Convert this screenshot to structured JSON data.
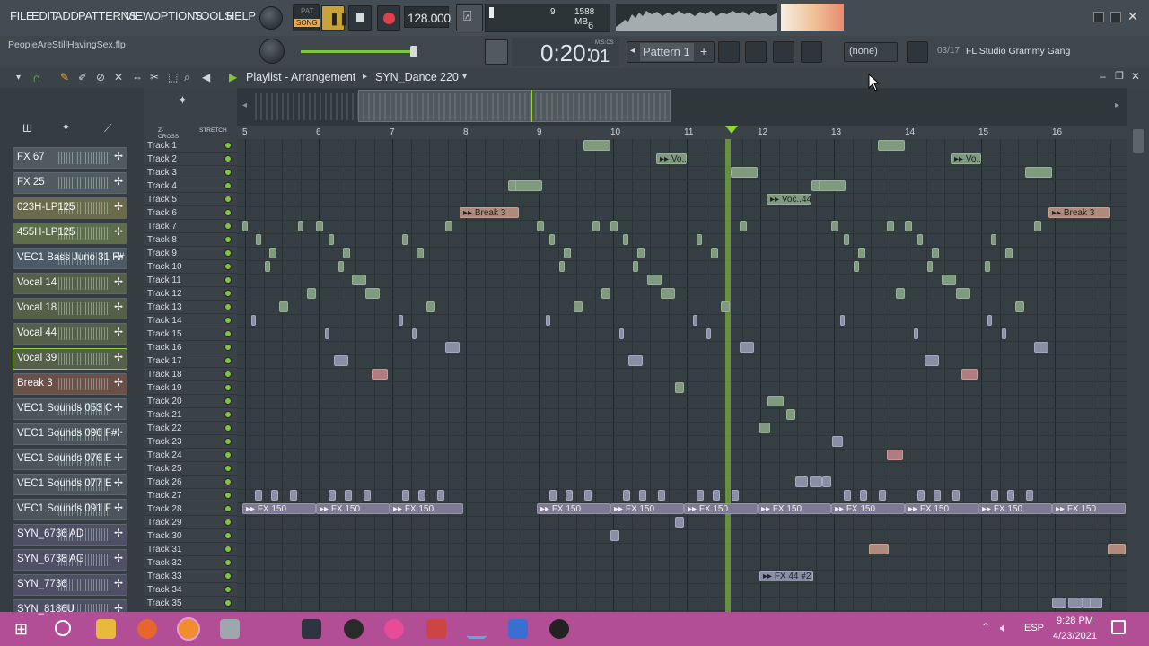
{
  "menu": [
    "FILE",
    "EDIT",
    "ADD",
    "PATTERNS",
    "VIEW",
    "OPTIONS",
    "TOOLS",
    "HELP"
  ],
  "transport": {
    "pat": "PAT",
    "song": "SONG",
    "tempo": "128.000",
    "cpu_top": "9",
    "mem": "1588 MB",
    "cpu_bottom": "6"
  },
  "filename": "PeopleAreStillHavingSex.flp",
  "time": {
    "main": "0:20:",
    "sub": "01",
    "label": "M:S:CS"
  },
  "pattern": {
    "label": "Pattern 1",
    "plus": "+"
  },
  "none_select": "(none)",
  "news": {
    "counter": "03/17",
    "text": "FL Studio Grammy Gang"
  },
  "playlist": {
    "title": "Playlist - Arrangement",
    "pattern": "SYN_Dance",
    "num": "220",
    "zcross": "Z-CROSS",
    "stretch": "STRETCH"
  },
  "ruler": [
    "5",
    "6",
    "7",
    "8",
    "9",
    "10",
    "11",
    "12",
    "13",
    "14",
    "15",
    "16"
  ],
  "channels": [
    "FX 67",
    "FX 25",
    "023H-LP125",
    "455H-LP125",
    "VEC1 Bass Juno 31 F#",
    "Vocal 14",
    "Vocal 18",
    "Vocal 44",
    "Vocal 39",
    "Break 3",
    "VEC1 Sounds 053 C",
    "VEC1 Sounds 096 F#",
    "VEC1 Sounds 076 E",
    "VEC1 Sounds 077 E",
    "VEC1 Sounds 091 F",
    "SYN_6736    AD",
    "SYN_6738    AG",
    "SYN_7736",
    "SYN_8186U"
  ],
  "tracks": [
    "Track 1",
    "Track 2",
    "Track 3",
    "Track 4",
    "Track 5",
    "Track 6",
    "Track 7",
    "Track 8",
    "Track 9",
    "Track 10",
    "Track 11",
    "Track 12",
    "Track 13",
    "Track 14",
    "Track 15",
    "Track 16",
    "Track 17",
    "Track 18",
    "Track 19",
    "Track 20",
    "Track 21",
    "Track 22",
    "Track 23",
    "Track 24",
    "Track 25",
    "Track 26",
    "Track 27",
    "Track 28",
    "Track 29",
    "Track 30",
    "Track 31",
    "Track 32",
    "Track 33",
    "Track 34",
    "Track 35"
  ],
  "clips": {
    "voc": "Vo...",
    "voc44": "Voc..44",
    "break3": "Break 3",
    "fx150": "FX 150",
    "fx44": "FX 44 #2"
  },
  "taskbar": {
    "lang": "ESP",
    "time": "9:28 PM",
    "date": "4/23/2021"
  },
  "colors": {
    "accent": "#7ec63e",
    "taskbar": "#b24e95",
    "playhead": "#8fd43a"
  }
}
